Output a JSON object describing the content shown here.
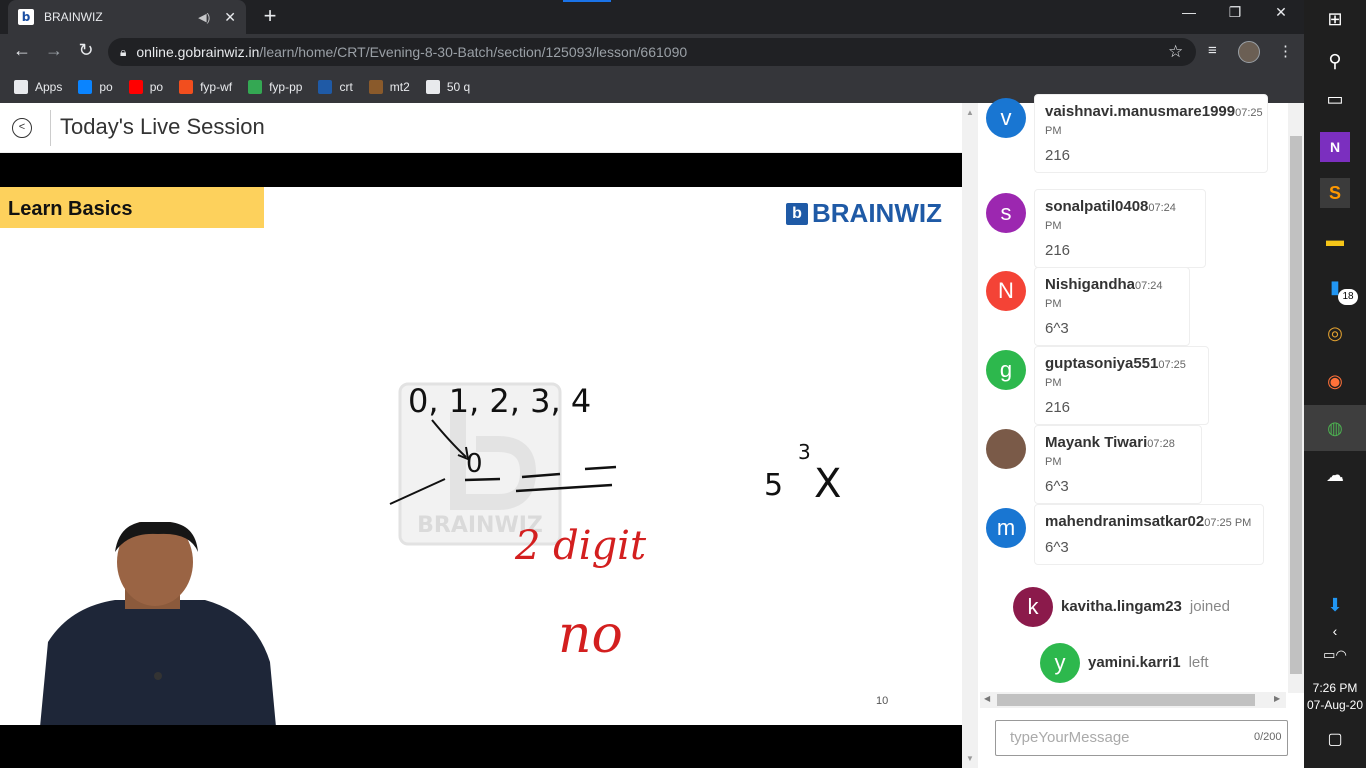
{
  "browser": {
    "tab_title": "BRAINWIZ",
    "url_host": "online.gobrainwiz.in",
    "url_path": "/learn/home/CRT/Evening-8-30-Batch/section/125093/lesson/661090",
    "bookmarks": [
      {
        "label": "Apps",
        "icon": "apps-grid-icon",
        "color": "#e8eaed"
      },
      {
        "label": "po",
        "icon": "edge-icon",
        "color": "#0a84ff"
      },
      {
        "label": "po",
        "icon": "youtube-icon",
        "color": "#ff0000"
      },
      {
        "label": "fyp-wf",
        "icon": "figma-icon",
        "color": "#f24e1e"
      },
      {
        "label": "fyp-pp",
        "icon": "image-icon",
        "color": "#34a853"
      },
      {
        "label": "crt",
        "icon": "brainwiz-icon",
        "color": "#1f5aa6"
      },
      {
        "label": "mt2",
        "icon": "cc-icon",
        "color": "#8a5a2b"
      },
      {
        "label": "50 q",
        "icon": "globe-icon",
        "color": "#e8eaed"
      }
    ]
  },
  "page": {
    "title": "Today's Live Session"
  },
  "slide": {
    "heading": "Learn Basics",
    "brand": "BRAINWIZ",
    "watermark": "BRAINWIZ",
    "page_number": "10",
    "handwriting": {
      "sequence": "0, 1, 2, 3, 4",
      "zero": "0",
      "power": "5",
      "exponent": "3",
      "cross": "X",
      "red_note_1": "2 digit",
      "red_note_2": "no"
    }
  },
  "chat": {
    "messages": [
      {
        "initial": "v",
        "user": "vaishnavi.manusmare1999",
        "time": "07:25 PM",
        "text": "216",
        "color": "#1976d2"
      },
      {
        "initial": "s",
        "user": "sonalpatil0408",
        "time": "07:24 PM",
        "text": "216",
        "color": "#9c27b0"
      },
      {
        "initial": "N",
        "user": "Nishigandha",
        "time": "07:24 PM",
        "text": "6^3",
        "color": "#f44336"
      },
      {
        "initial": "g",
        "user": "guptasoniya551",
        "time": "07:25 PM",
        "text": "216",
        "color": "#2db84d"
      },
      {
        "initial": "",
        "user": "Mayank Tiwari",
        "time": "07:28 PM",
        "text": "6^3",
        "color": "#7a5a48"
      },
      {
        "initial": "m",
        "user": "mahendranimsatkar02",
        "time": "07:25 PM",
        "text": "6^3",
        "color": "#1976d2"
      }
    ],
    "events": [
      {
        "initial": "k",
        "user": "kavitha.lingam23",
        "status": "joined",
        "color": "#8b1a4b"
      },
      {
        "initial": "y",
        "user": "yamini.karri1",
        "status": "left",
        "color": "#2db84d"
      }
    ],
    "input_placeholder": "typeYourMessage",
    "counter": "0/200"
  },
  "taskbar": {
    "badge": "18",
    "time": "7:26 PM",
    "date": "07-Aug-20"
  }
}
